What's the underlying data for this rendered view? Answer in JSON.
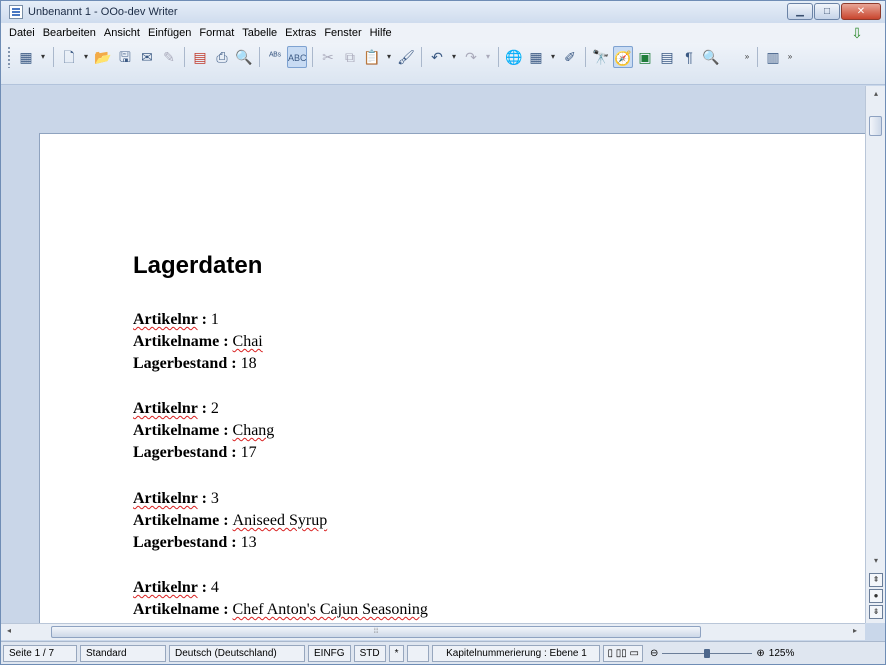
{
  "window": {
    "title": "Unbenannt 1 - OOo-dev Writer"
  },
  "menu": [
    "Datei",
    "Bearbeiten",
    "Ansicht",
    "Einfügen",
    "Format",
    "Tabelle",
    "Extras",
    "Fenster",
    "Hilfe"
  ],
  "document": {
    "heading": "Lagerdaten",
    "field_labels": {
      "id": "Artikelnr",
      "name": "Artikelname",
      "stock": "Lagerbestand"
    },
    "separator": " : ",
    "records": [
      {
        "id": "1",
        "name": "Chai",
        "stock": "18"
      },
      {
        "id": "2",
        "name": "Chang",
        "stock": "17"
      },
      {
        "id": "3",
        "name": "Aniseed Syrup",
        "stock": "13"
      },
      {
        "id": "4",
        "name": "Chef Anton's Cajun Seasoning",
        "stock": ""
      }
    ]
  },
  "status": {
    "page": "Seite 1 / 7",
    "style": "Standard",
    "language": "Deutsch (Deutschland)",
    "insert_mode": "EINFG",
    "selection_mode": "STD",
    "modified": "*",
    "chapter": "Kapitelnummerierung : Ebene 1",
    "zoom": "125%"
  }
}
